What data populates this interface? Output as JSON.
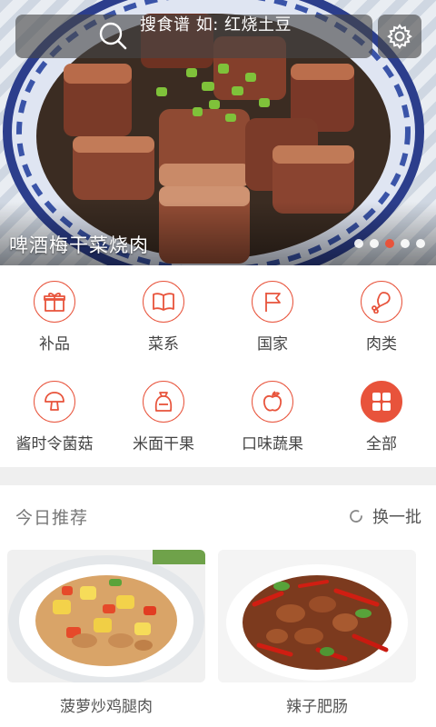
{
  "hero": {
    "title": "啤酒梅干菜烧肉",
    "slide_count": 5,
    "active_slide": 3
  },
  "search": {
    "placeholder": "搜食谱 如: 红烧土豆",
    "icon": "search-icon"
  },
  "settings": {
    "icon": "gear-icon"
  },
  "categories": [
    {
      "label": "补品",
      "icon": "gift-icon"
    },
    {
      "label": "菜系",
      "icon": "book-icon"
    },
    {
      "label": "国家",
      "icon": "flag-icon"
    },
    {
      "label": "肉类",
      "icon": "drumstick-icon"
    },
    {
      "label": "酱时令菌菇",
      "icon": "mushroom-icon"
    },
    {
      "label": "米面干果",
      "icon": "flour-sack-icon"
    },
    {
      "label": "口味蔬果",
      "icon": "apple-icon"
    },
    {
      "label": "全部",
      "icon": "grid-icon"
    }
  ],
  "recommend": {
    "title": "今日推荐",
    "refresh_label": "换一批",
    "items": [
      {
        "name": "菠萝炒鸡腿肉"
      },
      {
        "name": "辣子肥肠"
      }
    ]
  },
  "colors": {
    "accent": "#e8533b",
    "divider": "#efefef",
    "text": "#444444"
  }
}
